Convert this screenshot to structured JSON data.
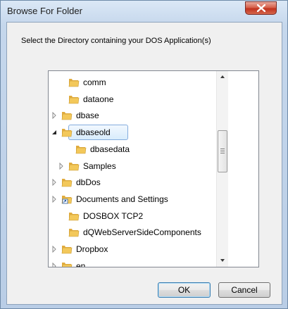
{
  "window": {
    "title": "Browse For Folder",
    "close_glyph": "X"
  },
  "dialog": {
    "description": "Select the Directory containing your DOS Application(s)"
  },
  "tree": {
    "items": [
      {
        "label": "comm",
        "expander": "none",
        "icon": "folder-icon",
        "selected": false
      },
      {
        "label": "dataone",
        "expander": "none",
        "icon": "folder-icon",
        "selected": false
      },
      {
        "label": "dbase",
        "expander": "collapsed",
        "icon": "folder-icon",
        "selected": false
      },
      {
        "label": "dbaseold",
        "expander": "expanded",
        "icon": "folder-icon",
        "selected": true
      },
      {
        "label": "dbasedata",
        "expander": "none",
        "icon": "folder-icon",
        "selected": false
      },
      {
        "label": "Samples",
        "expander": "collapsed",
        "icon": "folder-icon",
        "selected": false
      },
      {
        "label": "dbDos",
        "expander": "collapsed",
        "icon": "folder-icon",
        "selected": false
      },
      {
        "label": "Documents and Settings",
        "expander": "collapsed",
        "icon": "shortcut-folder-icon",
        "selected": false
      },
      {
        "label": "DOSBOX TCP2",
        "expander": "none",
        "icon": "folder-icon",
        "selected": false
      },
      {
        "label": "dQWebServerSideComponents",
        "expander": "none",
        "icon": "folder-icon",
        "selected": false
      },
      {
        "label": "Dropbox",
        "expander": "collapsed",
        "icon": "folder-icon",
        "selected": false
      },
      {
        "label": "en",
        "expander": "collapsed",
        "icon": "folder-icon",
        "selected": false
      }
    ]
  },
  "buttons": {
    "ok_label": "OK",
    "cancel_label": "Cancel"
  },
  "colors": {
    "selection_border": "#84acdd",
    "folder_yellow": "#f3c85a",
    "close_red": "#c1321e"
  }
}
